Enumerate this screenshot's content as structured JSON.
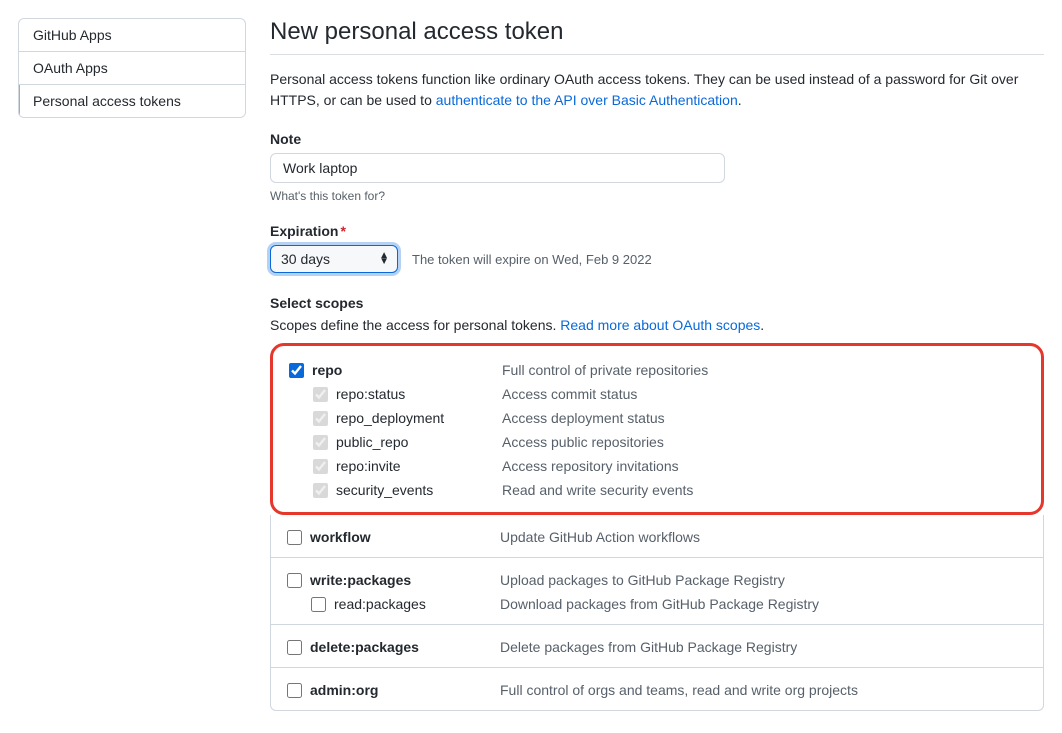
{
  "sidebar": {
    "items": [
      {
        "label": "GitHub Apps"
      },
      {
        "label": "OAuth Apps"
      },
      {
        "label": "Personal access tokens"
      }
    ]
  },
  "page": {
    "title": "New personal access token",
    "intro_before_link": "Personal access tokens function like ordinary OAuth access tokens. They can be used instead of a password for Git over HTTPS, or can be used to ",
    "intro_link": "authenticate to the API over Basic Authentication",
    "intro_after_link": "."
  },
  "note": {
    "label": "Note",
    "value": "Work laptop",
    "hint": "What's this token for?"
  },
  "expiration": {
    "label": "Expiration",
    "value": "30 days",
    "note": "The token will expire on Wed, Feb 9 2022"
  },
  "scopes": {
    "title": "Select scopes",
    "hint_before": "Scopes define the access for personal tokens. ",
    "hint_link": "Read more about OAuth scopes",
    "hint_after": ".",
    "repo": {
      "name": "repo",
      "desc": "Full control of private repositories",
      "children": [
        {
          "name": "repo:status",
          "desc": "Access commit status"
        },
        {
          "name": "repo_deployment",
          "desc": "Access deployment status"
        },
        {
          "name": "public_repo",
          "desc": "Access public repositories"
        },
        {
          "name": "repo:invite",
          "desc": "Access repository invitations"
        },
        {
          "name": "security_events",
          "desc": "Read and write security events"
        }
      ]
    },
    "workflow": {
      "name": "workflow",
      "desc": "Update GitHub Action workflows"
    },
    "write_packages": {
      "name": "write:packages",
      "desc": "Upload packages to GitHub Package Registry",
      "child": {
        "name": "read:packages",
        "desc": "Download packages from GitHub Package Registry"
      }
    },
    "delete_packages": {
      "name": "delete:packages",
      "desc": "Delete packages from GitHub Package Registry"
    },
    "admin_org": {
      "name": "admin:org",
      "desc": "Full control of orgs and teams, read and write org projects"
    }
  }
}
